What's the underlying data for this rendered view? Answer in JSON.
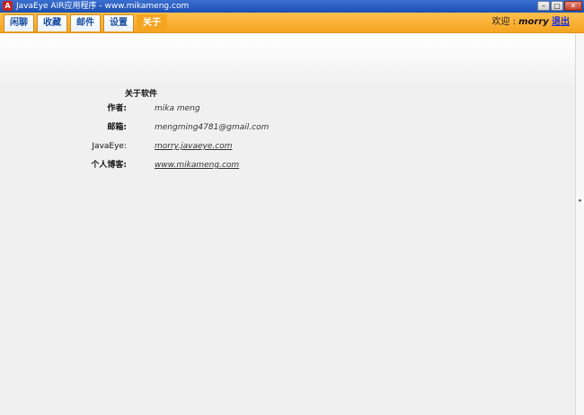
{
  "window": {
    "title": "JavaEye AIR应用程序 - www.mikameng.com",
    "controls": {
      "minimize": "–",
      "maximize": "□",
      "close": "✕"
    }
  },
  "tabs": [
    {
      "label": "闲聊"
    },
    {
      "label": "收藏"
    },
    {
      "label": "邮件"
    },
    {
      "label": "设置"
    },
    {
      "label": "关于",
      "active": true
    }
  ],
  "header": {
    "welcome_label": "欢迎 :",
    "username": "morry",
    "logout_label": "退出"
  },
  "about": {
    "title": "关于软件",
    "rows": [
      {
        "label": "作者:",
        "value": "mika meng"
      },
      {
        "label": "邮箱:",
        "value": "mengming4781@gmail.com"
      },
      {
        "label": "JavaEye:",
        "value": "morry.javaeye.com"
      },
      {
        "label": "个人博客:",
        "value": "www.mikameng.com"
      }
    ]
  },
  "colors": {
    "accent": "#f5a421",
    "tab_text": "#1a4ea0",
    "link": "#1a2ee0"
  }
}
